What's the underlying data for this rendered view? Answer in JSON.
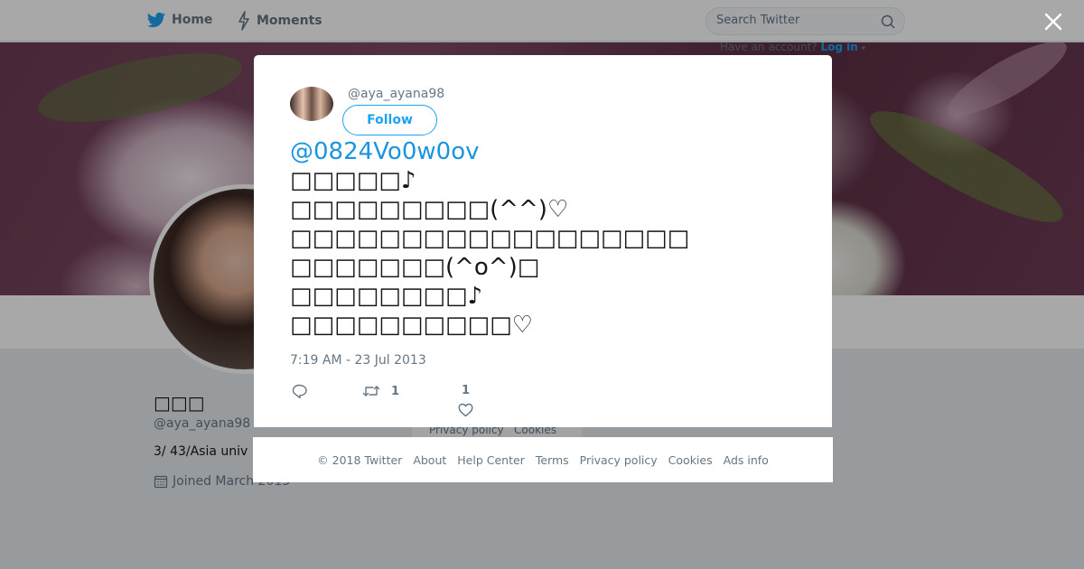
{
  "topnav": {
    "home_label": "Home",
    "moments_label": "Moments",
    "search_placeholder": "Search Twitter",
    "have_account_text": "Have an account?",
    "login_label": "Log in",
    "login_caret": "▾"
  },
  "profile": {
    "name": "□□□",
    "handle": "@aya_ayana98",
    "bio": "3/ 43/Asia univ ,",
    "joined": "Joined March 2013",
    "background_footer": [
      "Privacy policy",
      "Cookies"
    ]
  },
  "tweet": {
    "author_handle": "@aya_ayana98",
    "follow_label": "Follow",
    "mention": "@0824Vo0w0ov",
    "lines": [
      "□□□□□♪",
      "□□□□□□□□□(^^)♡",
      "□□□□□□□□□□□□□□□□□□",
      "□□□□□□□(^o^)□",
      "□□□□□□□□♪",
      "□□□□□□□□□□♡"
    ],
    "timestamp": "7:19 AM - 23 Jul 2013",
    "retweet_count": "1",
    "like_count": "1"
  },
  "footer": {
    "links": [
      "© 2018 Twitter",
      "About",
      "Help Center",
      "Terms",
      "Privacy policy",
      "Cookies",
      "Ads info"
    ]
  },
  "colors": {
    "accent": "#1da1f2",
    "mention": "#1b95e0",
    "muted_text": "#657786",
    "overlay": "rgba(0,0,0,0.34)"
  },
  "icons": {
    "home": "twitter-bird-icon",
    "moments": "lightning-icon",
    "search": "search-icon",
    "close": "close-icon",
    "reply": "reply-icon",
    "retweet": "retweet-icon",
    "like": "heart-icon",
    "joined": "calendar-icon"
  }
}
